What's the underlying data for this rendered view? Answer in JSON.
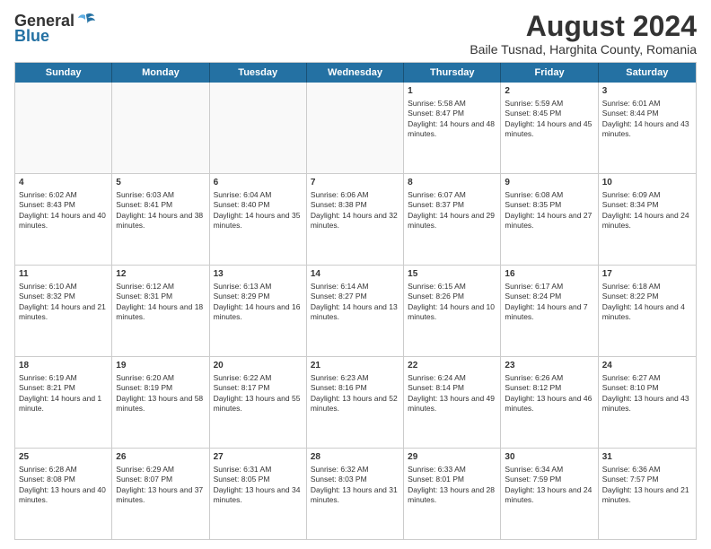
{
  "logo": {
    "general": "General",
    "blue": "Blue"
  },
  "title": "August 2024",
  "subtitle": "Baile Tusnad, Harghita County, Romania",
  "headers": [
    "Sunday",
    "Monday",
    "Tuesday",
    "Wednesday",
    "Thursday",
    "Friday",
    "Saturday"
  ],
  "weeks": [
    [
      {
        "day": "",
        "info": ""
      },
      {
        "day": "",
        "info": ""
      },
      {
        "day": "",
        "info": ""
      },
      {
        "day": "",
        "info": ""
      },
      {
        "day": "1",
        "info": "Sunrise: 5:58 AM\nSunset: 8:47 PM\nDaylight: 14 hours and 48 minutes."
      },
      {
        "day": "2",
        "info": "Sunrise: 5:59 AM\nSunset: 8:45 PM\nDaylight: 14 hours and 45 minutes."
      },
      {
        "day": "3",
        "info": "Sunrise: 6:01 AM\nSunset: 8:44 PM\nDaylight: 14 hours and 43 minutes."
      }
    ],
    [
      {
        "day": "4",
        "info": "Sunrise: 6:02 AM\nSunset: 8:43 PM\nDaylight: 14 hours and 40 minutes."
      },
      {
        "day": "5",
        "info": "Sunrise: 6:03 AM\nSunset: 8:41 PM\nDaylight: 14 hours and 38 minutes."
      },
      {
        "day": "6",
        "info": "Sunrise: 6:04 AM\nSunset: 8:40 PM\nDaylight: 14 hours and 35 minutes."
      },
      {
        "day": "7",
        "info": "Sunrise: 6:06 AM\nSunset: 8:38 PM\nDaylight: 14 hours and 32 minutes."
      },
      {
        "day": "8",
        "info": "Sunrise: 6:07 AM\nSunset: 8:37 PM\nDaylight: 14 hours and 29 minutes."
      },
      {
        "day": "9",
        "info": "Sunrise: 6:08 AM\nSunset: 8:35 PM\nDaylight: 14 hours and 27 minutes."
      },
      {
        "day": "10",
        "info": "Sunrise: 6:09 AM\nSunset: 8:34 PM\nDaylight: 14 hours and 24 minutes."
      }
    ],
    [
      {
        "day": "11",
        "info": "Sunrise: 6:10 AM\nSunset: 8:32 PM\nDaylight: 14 hours and 21 minutes."
      },
      {
        "day": "12",
        "info": "Sunrise: 6:12 AM\nSunset: 8:31 PM\nDaylight: 14 hours and 18 minutes."
      },
      {
        "day": "13",
        "info": "Sunrise: 6:13 AM\nSunset: 8:29 PM\nDaylight: 14 hours and 16 minutes."
      },
      {
        "day": "14",
        "info": "Sunrise: 6:14 AM\nSunset: 8:27 PM\nDaylight: 14 hours and 13 minutes."
      },
      {
        "day": "15",
        "info": "Sunrise: 6:15 AM\nSunset: 8:26 PM\nDaylight: 14 hours and 10 minutes."
      },
      {
        "day": "16",
        "info": "Sunrise: 6:17 AM\nSunset: 8:24 PM\nDaylight: 14 hours and 7 minutes."
      },
      {
        "day": "17",
        "info": "Sunrise: 6:18 AM\nSunset: 8:22 PM\nDaylight: 14 hours and 4 minutes."
      }
    ],
    [
      {
        "day": "18",
        "info": "Sunrise: 6:19 AM\nSunset: 8:21 PM\nDaylight: 14 hours and 1 minute."
      },
      {
        "day": "19",
        "info": "Sunrise: 6:20 AM\nSunset: 8:19 PM\nDaylight: 13 hours and 58 minutes."
      },
      {
        "day": "20",
        "info": "Sunrise: 6:22 AM\nSunset: 8:17 PM\nDaylight: 13 hours and 55 minutes."
      },
      {
        "day": "21",
        "info": "Sunrise: 6:23 AM\nSunset: 8:16 PM\nDaylight: 13 hours and 52 minutes."
      },
      {
        "day": "22",
        "info": "Sunrise: 6:24 AM\nSunset: 8:14 PM\nDaylight: 13 hours and 49 minutes."
      },
      {
        "day": "23",
        "info": "Sunrise: 6:26 AM\nSunset: 8:12 PM\nDaylight: 13 hours and 46 minutes."
      },
      {
        "day": "24",
        "info": "Sunrise: 6:27 AM\nSunset: 8:10 PM\nDaylight: 13 hours and 43 minutes."
      }
    ],
    [
      {
        "day": "25",
        "info": "Sunrise: 6:28 AM\nSunset: 8:08 PM\nDaylight: 13 hours and 40 minutes."
      },
      {
        "day": "26",
        "info": "Sunrise: 6:29 AM\nSunset: 8:07 PM\nDaylight: 13 hours and 37 minutes."
      },
      {
        "day": "27",
        "info": "Sunrise: 6:31 AM\nSunset: 8:05 PM\nDaylight: 13 hours and 34 minutes."
      },
      {
        "day": "28",
        "info": "Sunrise: 6:32 AM\nSunset: 8:03 PM\nDaylight: 13 hours and 31 minutes."
      },
      {
        "day": "29",
        "info": "Sunrise: 6:33 AM\nSunset: 8:01 PM\nDaylight: 13 hours and 28 minutes."
      },
      {
        "day": "30",
        "info": "Sunrise: 6:34 AM\nSunset: 7:59 PM\nDaylight: 13 hours and 24 minutes."
      },
      {
        "day": "31",
        "info": "Sunrise: 6:36 AM\nSunset: 7:57 PM\nDaylight: 13 hours and 21 minutes."
      }
    ]
  ]
}
